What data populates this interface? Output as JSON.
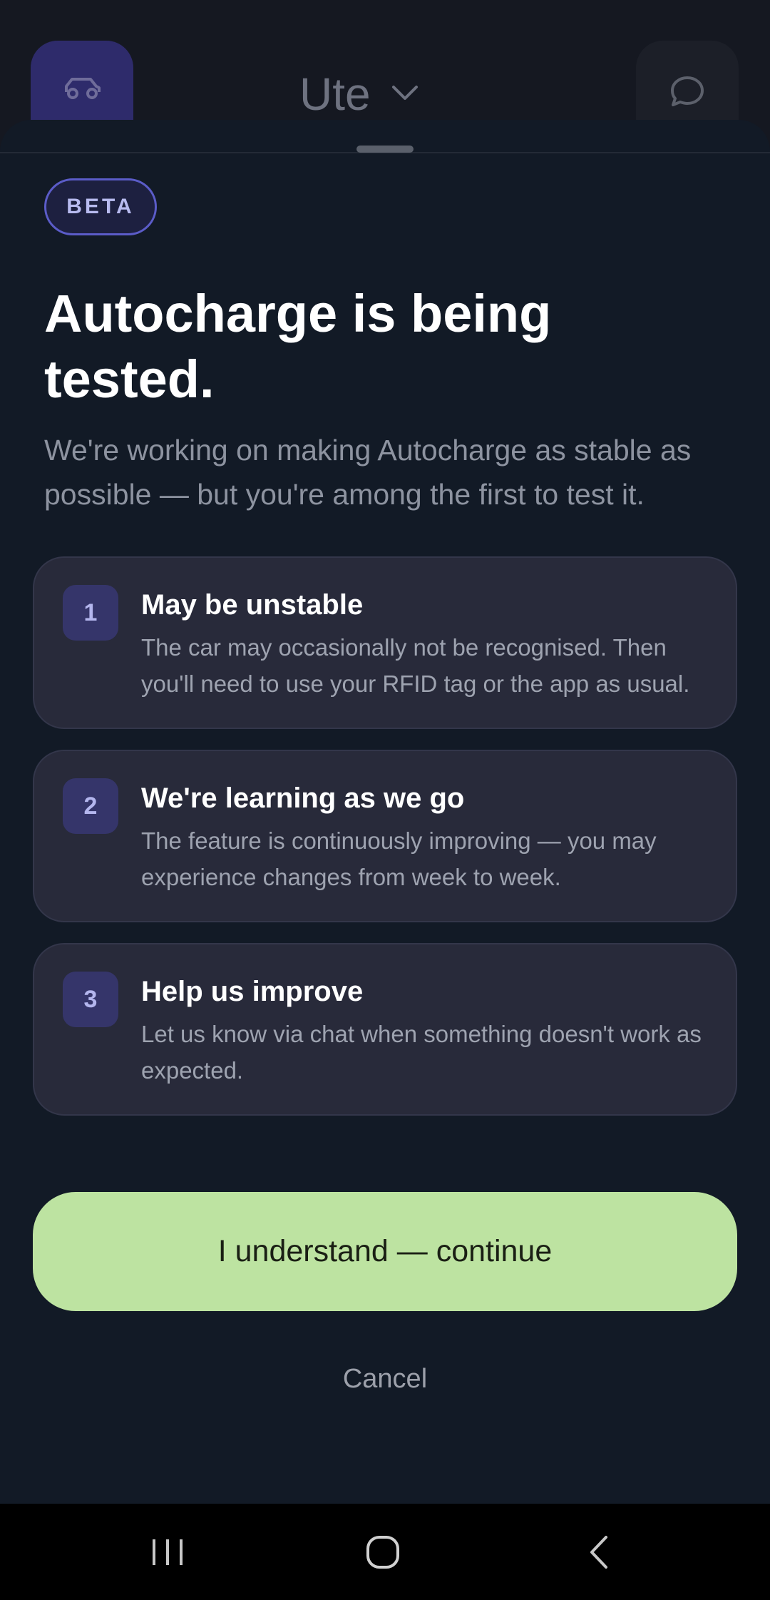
{
  "header": {
    "vehicle_name": "Ute",
    "car_icon": "car-icon",
    "chat_icon": "chat-bubble-icon",
    "dropdown_icon": "chevron-down-icon"
  },
  "sheet": {
    "badge": "BETA",
    "title": "Autocharge is being tested.",
    "subtitle": "We're working on making Autocharge as stable as possible — but you're among the first to test it.",
    "items": [
      {
        "number": "1",
        "title": "May be unstable",
        "body": "The car may occasionally not be recognised. Then you'll need to use your RFID tag or the app as usual."
      },
      {
        "number": "2",
        "title": "We're learning as we go",
        "body": "The feature is continuously improving — you may experience changes from week to week."
      },
      {
        "number": "3",
        "title": "Help us improve",
        "body": "Let us know via chat when something doesn't work as expected."
      }
    ],
    "primary_button": "I understand — continue",
    "cancel_button": "Cancel"
  },
  "navbar": {
    "recents_icon": "recents-icon",
    "home_icon": "home-icon",
    "back_icon": "back-icon"
  },
  "colors": {
    "accent_green": "#bde3a1",
    "badge_border": "#5b5cc8",
    "sheet_bg": "#121a26",
    "card_bg": "#282a3a"
  }
}
